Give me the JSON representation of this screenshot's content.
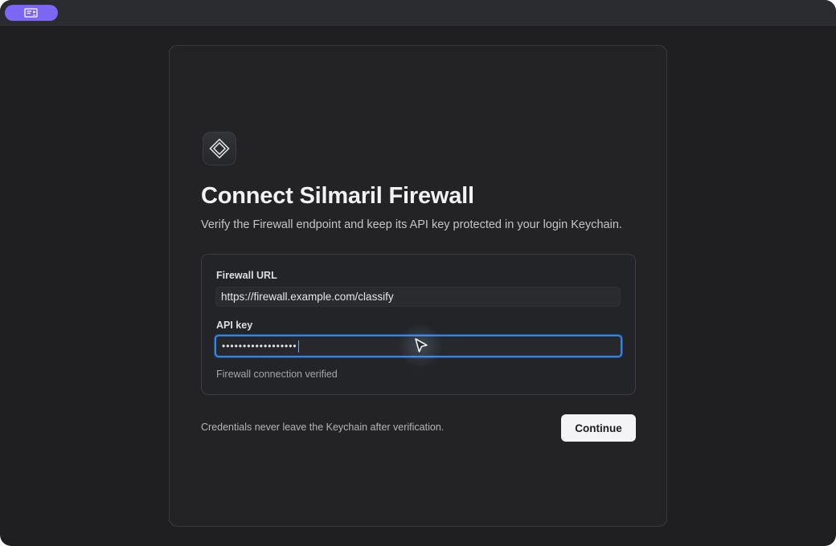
{
  "window": {
    "badge_icon": "monitor-person-icon"
  },
  "card": {
    "app_icon": "diamond-logo-icon",
    "title": "Connect Silmaril Firewall",
    "subtitle": "Verify the Firewall endpoint and keep its API key protected in your login Keychain.",
    "form": {
      "url_label": "Firewall URL",
      "url_value": "https://firewall.example.com/classify",
      "key_label": "API key",
      "key_value": "••••••••••••••••••",
      "status": "Firewall connection verified"
    },
    "footnote": "Credentials never leave the Keychain after verification.",
    "continue_label": "Continue"
  },
  "colors": {
    "accent_pill": "#7b66f6",
    "focus_ring": "#3a82e0",
    "background": "#1f1f21",
    "button": "#f4f4f6"
  }
}
